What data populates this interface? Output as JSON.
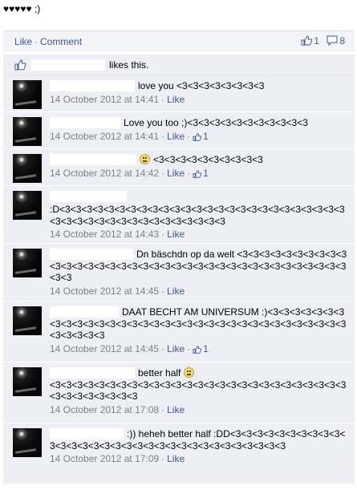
{
  "status": {
    "text": "♥♥♥♥♥ ;)"
  },
  "actions": {
    "like": "Like",
    "comment": "Comment",
    "like_count": "1",
    "comment_count": "8"
  },
  "likes_bar": {
    "text": "likes this."
  },
  "comments": [
    {
      "text": "love you <3<3<3<3<3<3<3<3",
      "time": "14 October 2012 at 14:41",
      "like": "Like",
      "likes": ""
    },
    {
      "text": "Love you too ;)<3<3<3<3<3<3<3<3<3<3<3",
      "time": "14 October 2012 at 14:41",
      "like": "Like",
      "likes": "1"
    },
    {
      "text": "<3<3<3<3<3<3<3<3<3<3",
      "time": "14 October 2012 at 14:42",
      "like": "Like",
      "likes": "1"
    },
    {
      "text": ":D<3<3<3<3<3<3<3<3<3<3<3<3<3<3<3<3<3<3<3<3<3<3<3<3<3<3<3<3<3<3<3<3<3<3<3<3<3<3<3<3<3<3",
      "time": "14 October 2012 at 14:43",
      "like": "Like",
      "likes": ""
    },
    {
      "text": "Dn bäschdn op da welt <3<3<3<3<3<3<3<3<3<3<3<3<3<3<3<3<3<3<3<3<3<3<3<3<3<3<3<3<3<3<3<3<3<3<3<3<3<3<3",
      "time": "14 October 2012 at 14:45",
      "like": "Like",
      "likes": ""
    },
    {
      "text": "DAAT BECHT AM UNIVERSUM :)<3<3<3<3<3<3<3<3<3<3<3<3<3<3<3<3<3<3<3<3<3<3<3<3<3<3<3<3<3<3<3<3<3<3<3<3<3<3<3",
      "time": "14 October 2012 at 14:45",
      "like": "Like",
      "likes": "1"
    },
    {
      "text": "better half",
      "text2": "<3<3<3<3<3<3<3<3<3<3<3<3<3<3<3<3<3<3<3<3<3<3<3<3<3<3<3<3<3<3<3<3<3<3<3",
      "time": "14 October 2012 at 17:08",
      "like": "Like",
      "likes": ""
    },
    {
      "text": ":)) heheh better half :DD<3<3<3<3<3<3<3<3<3<3<3<3<3<3<3<3<3<3<3<3<3<3<3<3<3<3<3<3<3<3<3<3",
      "time": "14 October 2012 at 17:09",
      "like": "Like",
      "likes": ""
    }
  ]
}
